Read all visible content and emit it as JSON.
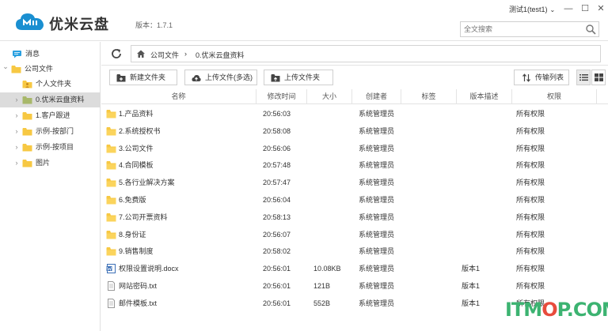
{
  "app": {
    "name": "优米云盘",
    "version_label": "版本：1.7.1",
    "user": "测试1(test1)",
    "window_controls": {
      "minimize": "—",
      "maximize": "☐",
      "close": "✕"
    }
  },
  "search": {
    "placeholder": "全文搜索"
  },
  "sidebar": {
    "items": [
      {
        "label": "消息",
        "icon": "message-icon",
        "level": 0,
        "expand": ""
      },
      {
        "label": "公司文件",
        "icon": "folder-icon",
        "level": 0,
        "expand": "⌄"
      },
      {
        "label": "个人文件夹",
        "icon": "personal-folder-icon",
        "level": 1,
        "expand": ""
      },
      {
        "label": "0.优米云盘资料",
        "icon": "folder-icon",
        "level": 1,
        "expand": "›",
        "selected": true
      },
      {
        "label": "1.客户跟进",
        "icon": "folder-icon",
        "level": 1,
        "expand": "›"
      },
      {
        "label": "示例-按部门",
        "icon": "folder-icon",
        "level": 1,
        "expand": "›"
      },
      {
        "label": "示例-按项目",
        "icon": "folder-icon",
        "level": 1,
        "expand": "›"
      },
      {
        "label": "图片",
        "icon": "folder-icon",
        "level": 1,
        "expand": "›"
      }
    ]
  },
  "breadcrumb": {
    "items": [
      "公司文件",
      "0.优米云盘资料"
    ],
    "separator": "›"
  },
  "toolbar": {
    "new_folder": "新建文件夹",
    "upload_files": "上传文件(多选)",
    "upload_folder": "上传文件夹",
    "transfer_list": "传输列表"
  },
  "table": {
    "columns": [
      "名称",
      "修改时间",
      "大小",
      "创建者",
      "标签",
      "版本描述",
      "权限"
    ],
    "rows": [
      {
        "type": "folder",
        "name": "1.产品资料",
        "time": "20:56:03",
        "size": "",
        "creator": "系统管理员",
        "tag": "",
        "version": "",
        "permission": "所有权限"
      },
      {
        "type": "folder",
        "name": "2.系统授权书",
        "time": "20:58:08",
        "size": "",
        "creator": "系统管理员",
        "tag": "",
        "version": "",
        "permission": "所有权限"
      },
      {
        "type": "folder",
        "name": "3.公司文件",
        "time": "20:56:06",
        "size": "",
        "creator": "系统管理员",
        "tag": "",
        "version": "",
        "permission": "所有权限"
      },
      {
        "type": "folder",
        "name": "4.合同模板",
        "time": "20:57:48",
        "size": "",
        "creator": "系统管理员",
        "tag": "",
        "version": "",
        "permission": "所有权限"
      },
      {
        "type": "folder",
        "name": "5.各行业解决方案",
        "time": "20:57:47",
        "size": "",
        "creator": "系统管理员",
        "tag": "",
        "version": "",
        "permission": "所有权限"
      },
      {
        "type": "folder",
        "name": "6.免费版",
        "time": "20:56:04",
        "size": "",
        "creator": "系统管理员",
        "tag": "",
        "version": "",
        "permission": "所有权限"
      },
      {
        "type": "folder",
        "name": "7.公司开票资料",
        "time": "20:58:13",
        "size": "",
        "creator": "系统管理员",
        "tag": "",
        "version": "",
        "permission": "所有权限"
      },
      {
        "type": "folder",
        "name": "8.身份证",
        "time": "20:56:07",
        "size": "",
        "creator": "系统管理员",
        "tag": "",
        "version": "",
        "permission": "所有权限"
      },
      {
        "type": "folder",
        "name": "9.销售制度",
        "time": "20:58:02",
        "size": "",
        "creator": "系统管理员",
        "tag": "",
        "version": "",
        "permission": "所有权限"
      },
      {
        "type": "docx",
        "name": "权限设置说明.docx",
        "time": "20:56:01",
        "size": "10.08KB",
        "creator": "系统管理员",
        "tag": "",
        "version": "版本1",
        "permission": "所有权限"
      },
      {
        "type": "txt",
        "name": "网站密码.txt",
        "time": "20:56:01",
        "size": "121B",
        "creator": "系统管理员",
        "tag": "",
        "version": "版本1",
        "permission": "所有权限"
      },
      {
        "type": "txt",
        "name": "邮件模板.txt",
        "time": "20:56:01",
        "size": "552B",
        "creator": "系统管理员",
        "tag": "",
        "version": "版本1",
        "permission": "所有权限"
      }
    ]
  },
  "watermark": {
    "text_a": "ITM",
    "text_b": "O",
    "text_c": "P.COM"
  },
  "colors": {
    "accent": "#1a8fd1",
    "folder": "#f7c843",
    "selected_bg": "#dcdcdc",
    "watermark_green": "#3cb371",
    "watermark_red": "#e84c3d"
  }
}
